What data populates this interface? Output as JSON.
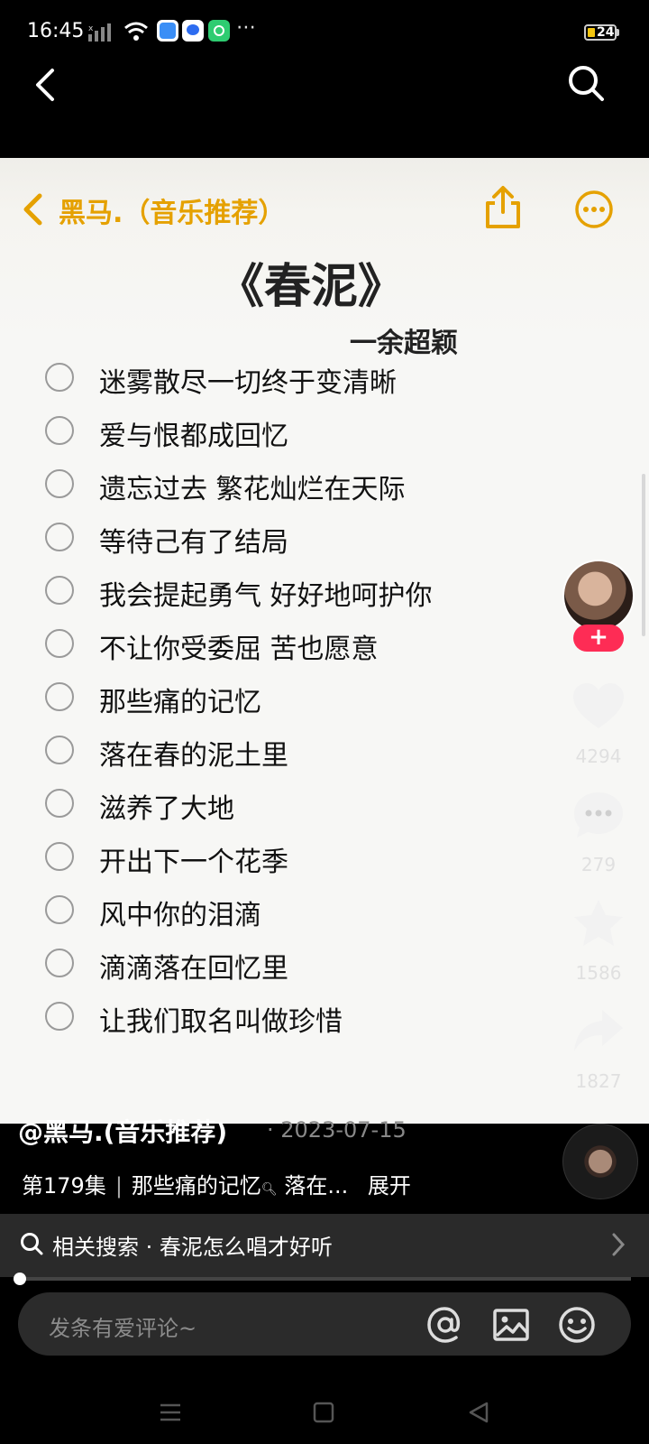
{
  "status_bar": {
    "time": "16:45",
    "battery": "24"
  },
  "note": {
    "title": "黑马.（音乐推荐）",
    "song_title": "《春泥》",
    "singer": "一余超颖",
    "lines": [
      "迷雾散尽一切终于变清晰",
      "爱与恨都成回忆",
      "遗忘过去 繁花灿烂在天际",
      "等待己有了结局",
      "我会提起勇气 好好地呵护你",
      "不让你受委屈 苦也愿意",
      "那些痛的记忆",
      "落在春的泥土里",
      "滋养了大地",
      "开出下一个花季",
      "风中你的泪滴",
      "滴滴落在回忆里",
      "让我们取名叫做珍惜"
    ]
  },
  "actions": {
    "likes": "4294",
    "comments": "279",
    "favorites": "1586",
    "shares": "1827"
  },
  "caption": {
    "author": "@黑马.(音乐推荐)",
    "date": "· 2023-07-15",
    "episode": "第179集",
    "snippet": "那些痛的记忆",
    "snippet_tail": "落在...",
    "expand": "展开"
  },
  "related": {
    "text": "相关搜索 · 春泥怎么唱才好听"
  },
  "comment": {
    "placeholder": "发条有爱评论~"
  },
  "colors": {
    "accent": "#e5a100",
    "follow": "#fe2c55"
  }
}
